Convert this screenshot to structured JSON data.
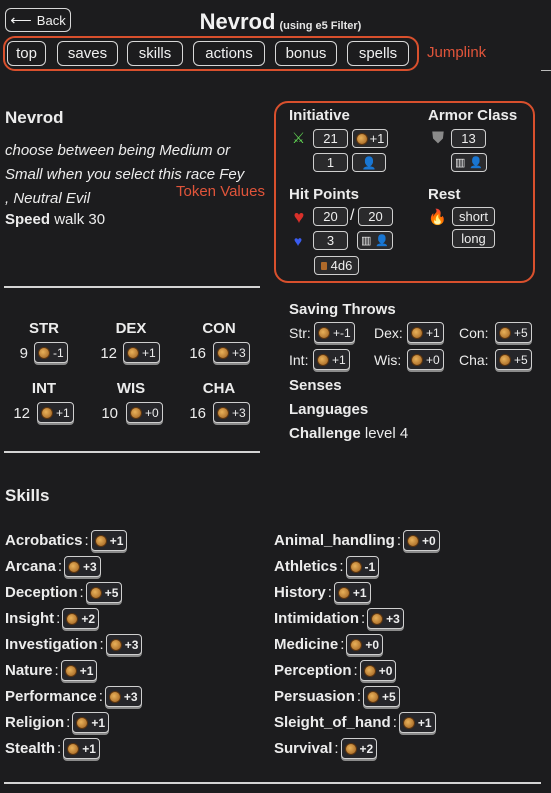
{
  "header": {
    "back_label": "Back",
    "title": "Nevrod",
    "subtitle": "(using e5 Filter)"
  },
  "jumplinks": {
    "items": [
      "top",
      "saves",
      "skills",
      "actions",
      "bonus",
      "spells"
    ],
    "annotation": "Jumplink"
  },
  "character": {
    "name": "Nevrod",
    "race_line1": "choose between being Medium or",
    "race_line2": "Small when you select this race Fey",
    "race_line3": ", Neutral Evil",
    "speed_label": "Speed",
    "speed_value": "walk 30",
    "token_annotation": "Token Values"
  },
  "tokens": {
    "initiative": {
      "label": "Initiative",
      "value": "21",
      "mod": "+1",
      "alt": "1"
    },
    "armor": {
      "label": "Armor Class",
      "value": "13"
    },
    "hp": {
      "label": "Hit Points",
      "current": "20",
      "sep": "/",
      "max": "20",
      "temp": "3",
      "hit_dice": "4d6"
    },
    "rest": {
      "label": "Rest",
      "short": "short",
      "long": "long"
    }
  },
  "abilities": [
    {
      "name": "STR",
      "score": "9",
      "mod": "-1"
    },
    {
      "name": "DEX",
      "score": "12",
      "mod": "+1"
    },
    {
      "name": "CON",
      "score": "16",
      "mod": "+3"
    },
    {
      "name": "INT",
      "score": "12",
      "mod": "+1"
    },
    {
      "name": "WIS",
      "score": "10",
      "mod": "+0"
    },
    {
      "name": "CHA",
      "score": "16",
      "mod": "+3"
    }
  ],
  "saving_throws": {
    "title": "Saving Throws",
    "items": [
      {
        "label": "Str:",
        "mod": "+-1"
      },
      {
        "label": "Dex:",
        "mod": "+1"
      },
      {
        "label": "Con:",
        "mod": "+5"
      },
      {
        "label": "Int:",
        "mod": "+1"
      },
      {
        "label": "Wis:",
        "mod": "+0"
      },
      {
        "label": "Cha:",
        "mod": "+5"
      }
    ]
  },
  "senses_label": "Senses",
  "languages_label": "Languages",
  "challenge": {
    "label": "Challenge",
    "value": "level 4"
  },
  "skills": {
    "title": "Skills",
    "left": [
      {
        "name": "Acrobatics",
        "mod": "+1"
      },
      {
        "name": "Arcana",
        "mod": "+3"
      },
      {
        "name": "Deception",
        "mod": "+5"
      },
      {
        "name": "Insight",
        "mod": "+2"
      },
      {
        "name": "Investigation",
        "mod": "+3"
      },
      {
        "name": "Nature",
        "mod": "+1"
      },
      {
        "name": "Performance",
        "mod": "+3"
      },
      {
        "name": "Religion",
        "mod": "+1"
      },
      {
        "name": "Stealth",
        "mod": "+1"
      }
    ],
    "right": [
      {
        "name": "Animal_handling",
        "mod": "+0"
      },
      {
        "name": "Athletics",
        "mod": "-1"
      },
      {
        "name": "History",
        "mod": "+1"
      },
      {
        "name": "Intimidation",
        "mod": "+3"
      },
      {
        "name": "Medicine",
        "mod": "+0"
      },
      {
        "name": "Perception",
        "mod": "+0"
      },
      {
        "name": "Persuasion",
        "mod": "+5"
      },
      {
        "name": "Sleight_of_hand",
        "mod": "+1"
      },
      {
        "name": "Survival",
        "mod": "+2"
      }
    ]
  },
  "colors": {
    "background": "#1c1c1e",
    "annotation": "#d9502d",
    "heart": "#d9302a",
    "temp_heart": "#3a5cf0"
  },
  "icons": [
    "arrow-left-icon",
    "dagger-icon",
    "die-icon",
    "person-icon",
    "shield-icon",
    "map-icon",
    "heart-icon",
    "campfire-icon"
  ]
}
